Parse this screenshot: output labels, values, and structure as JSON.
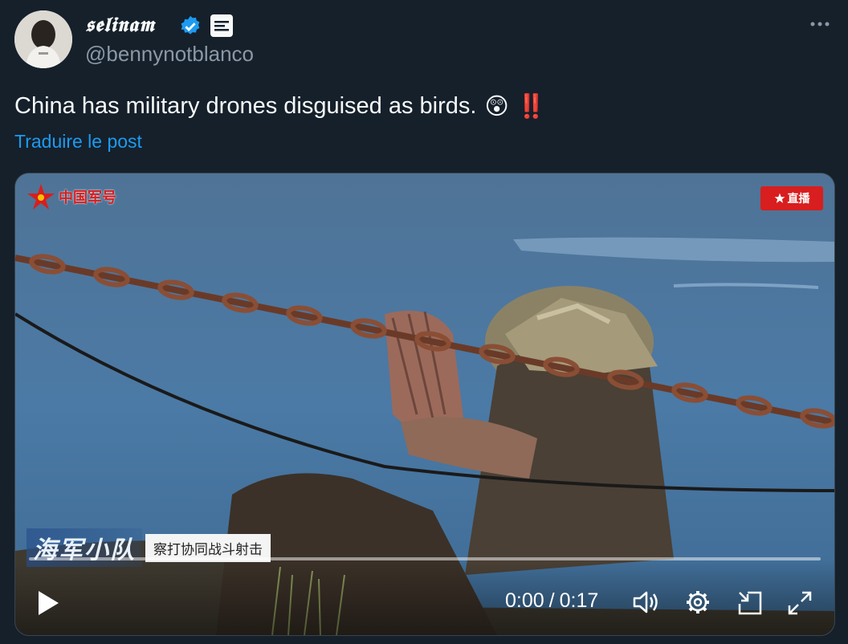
{
  "author": {
    "display_name": "𝖘𝖊𝖑𝖎𝖓𝖆𝖒",
    "handle": "@bennynotblanco",
    "verified_icon": "verified-badge-icon",
    "org_icon": "affiliate-badge-icon"
  },
  "tweet": {
    "text": "China has military drones disguised as birds.",
    "emojis": [
      "😲",
      "‼️"
    ],
    "translate_label": "Traduire le post"
  },
  "video": {
    "channel_logo_text": "中国军号",
    "live_badge": "直播",
    "caption_title": "海军小队",
    "caption_subtitle": "察打协同战斗射击",
    "time_current": "0:00",
    "time_separator": "/",
    "time_total": "0:17",
    "progress": 0
  },
  "colors": {
    "background": "#15202b",
    "link": "#1d9bf0",
    "verified": "#1d9bf0",
    "muted": "#8b98a5"
  }
}
